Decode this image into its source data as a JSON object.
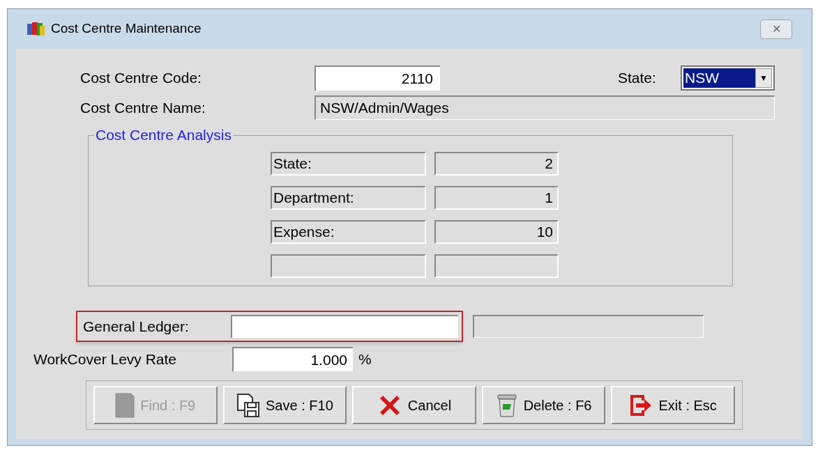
{
  "window": {
    "title": "Cost Centre Maintenance",
    "close": "✕"
  },
  "code": {
    "label": "Cost Centre Code:",
    "value": "2110"
  },
  "state": {
    "label": "State:",
    "value": "NSW",
    "selected": true,
    "arrow": "▼"
  },
  "name": {
    "label": "Cost Centre Name:",
    "value": "NSW/Admin/Wages"
  },
  "analysis": {
    "title": "Cost Centre Analysis",
    "rows": [
      {
        "label": "State:",
        "value": "2"
      },
      {
        "label": "Department:",
        "value": "1"
      },
      {
        "label": "Expense:",
        "value": "10"
      },
      {}
    ]
  },
  "general_ledger": {
    "label": "General Ledger:",
    "highlighted": true
  },
  "workcover": {
    "label": "WorkCover Levy Rate",
    "value": "1.000",
    "suffix": "%"
  },
  "buttons": [
    {
      "label": "Find : F9",
      "disabled": true
    },
    {
      "label": "Save : F10",
      "disabled": false
    },
    {
      "label": "Cancel",
      "disabled": false
    },
    {
      "label": "Delete : F6",
      "disabled": false
    },
    {
      "label": "Exit : Esc",
      "disabled": false
    }
  ]
}
